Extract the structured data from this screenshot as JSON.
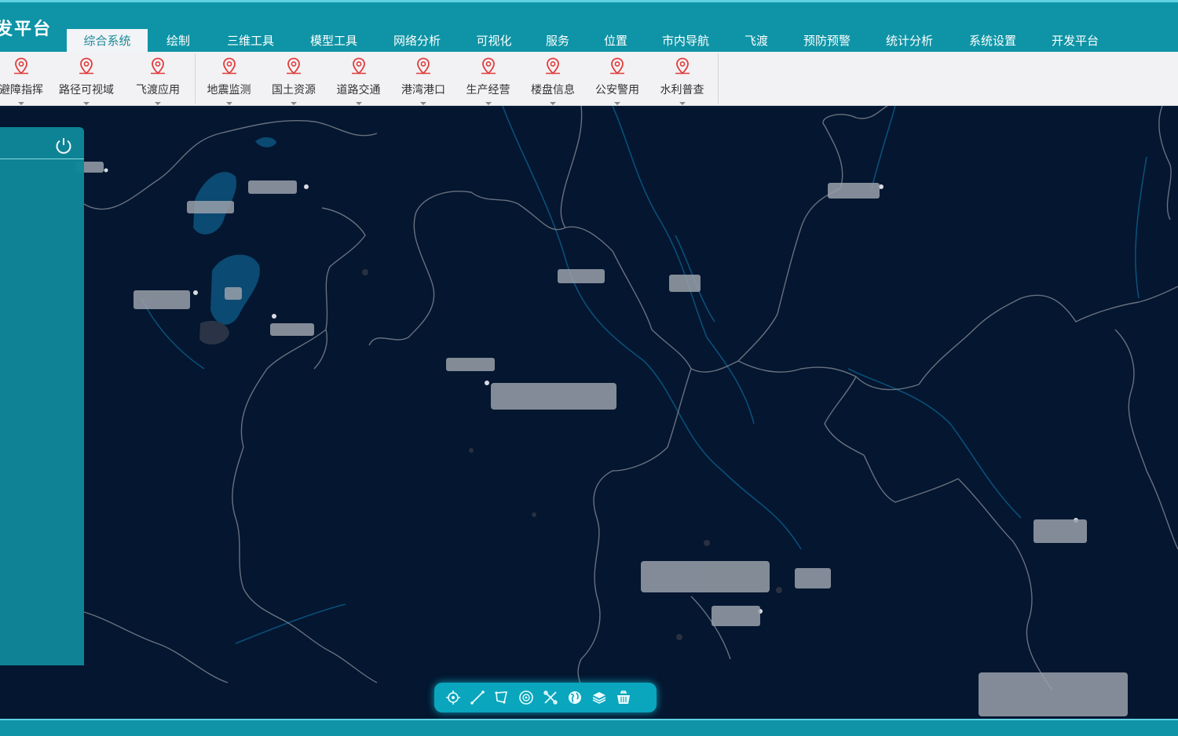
{
  "app": {
    "title": "发平台"
  },
  "tabs": [
    {
      "label": "综合系统",
      "active": true
    },
    {
      "label": "绘制"
    },
    {
      "label": "三维工具"
    },
    {
      "label": "模型工具"
    },
    {
      "label": "网络分析"
    },
    {
      "label": "可视化"
    },
    {
      "label": "服务"
    },
    {
      "label": "位置"
    },
    {
      "label": "市内导航"
    },
    {
      "label": "飞渡"
    },
    {
      "label": "预防预警"
    },
    {
      "label": "统计分析"
    },
    {
      "label": "系统设置"
    },
    {
      "label": "开发平台"
    }
  ],
  "ribbon": {
    "group1": [
      {
        "label": "避障指挥",
        "icon": "location-pin-icon"
      },
      {
        "label": "路径可视域",
        "icon": "location-pin-icon"
      },
      {
        "label": "飞渡应用",
        "icon": "location-pin-icon"
      }
    ],
    "group2": [
      {
        "label": "地震监测",
        "icon": "location-pin-icon"
      },
      {
        "label": "国土资源",
        "icon": "location-pin-icon"
      },
      {
        "label": "道路交通",
        "icon": "location-pin-icon"
      },
      {
        "label": "港湾港口",
        "icon": "location-pin-icon"
      },
      {
        "label": "生产经营",
        "icon": "location-pin-icon"
      },
      {
        "label": "楼盘信息",
        "icon": "location-pin-icon"
      },
      {
        "label": "公安警用",
        "icon": "location-pin-icon"
      },
      {
        "label": "水利普查",
        "icon": "location-pin-icon"
      }
    ]
  },
  "map_labels": {
    "l1": "",
    "l2": "",
    "l3": "",
    "l4": "",
    "l5": "",
    "l6": "",
    "l7": "",
    "l8": "",
    "l9": "",
    "l10": "",
    "l11": "",
    "l12": "",
    "l13": "",
    "l14": "",
    "l15": "",
    "l16": ""
  },
  "toolbar": [
    {
      "icon": "locate-icon"
    },
    {
      "icon": "measure-line-icon"
    },
    {
      "icon": "measure-area-icon"
    },
    {
      "icon": "compass-icon"
    },
    {
      "icon": "tools-icon"
    },
    {
      "icon": "globe-icon"
    },
    {
      "icon": "layers-icon"
    },
    {
      "icon": "clear-icon"
    }
  ],
  "status": {
    "coords": "",
    "company": ""
  },
  "colors": {
    "brand": "#0e94a6",
    "ribbon_bg": "#f2f2f4",
    "map_bg": "#041630",
    "pin": "#e23c3c"
  }
}
